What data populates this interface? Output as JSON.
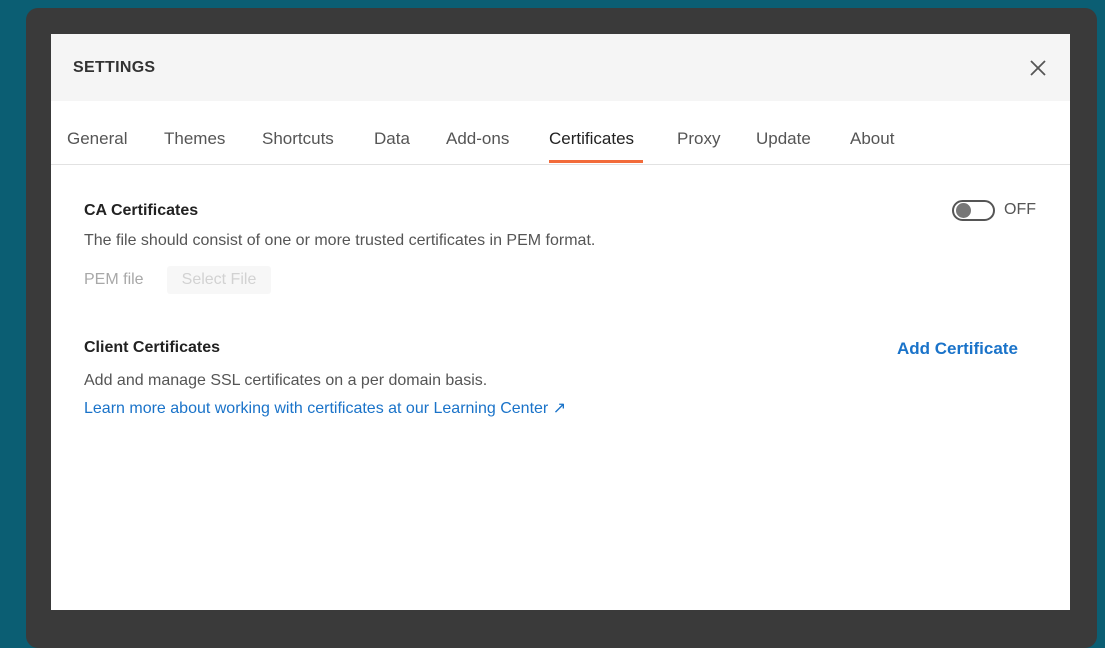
{
  "dialog": {
    "title": "SETTINGS",
    "close_icon": "close-icon"
  },
  "tabs": [
    {
      "label": "General"
    },
    {
      "label": "Themes"
    },
    {
      "label": "Shortcuts"
    },
    {
      "label": "Data"
    },
    {
      "label": "Add-ons"
    },
    {
      "label": "Certificates",
      "active": true
    },
    {
      "label": "Proxy"
    },
    {
      "label": "Update"
    },
    {
      "label": "About"
    }
  ],
  "ca": {
    "title": "CA Certificates",
    "description": "The file should consist of one or more trusted certificates in PEM format.",
    "toggle_state": "OFF",
    "pem_label": "PEM file",
    "select_file_label": "Select File"
  },
  "client": {
    "title": "Client Certificates",
    "add_button": "Add Certificate",
    "description": "Add and manage SSL certificates on a per domain basis.",
    "learn_link": "Learn more about working with certificates at our Learning Center ↗"
  },
  "colors": {
    "accent_tab": "#f26b3a",
    "link": "#1a73c9",
    "background": "#0b5e73"
  }
}
